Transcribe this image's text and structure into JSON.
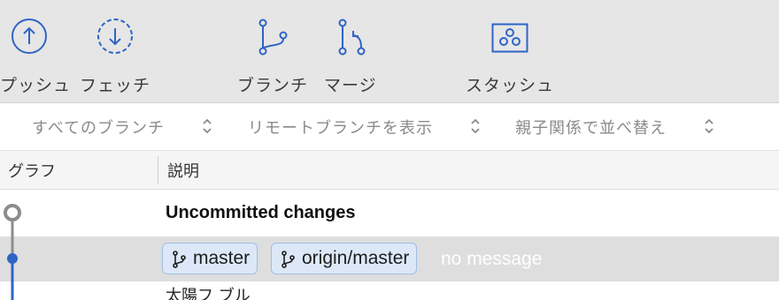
{
  "toolbar": {
    "push_label": "プッシュ",
    "fetch_label": "フェッチ",
    "branch_label": "ブランチ",
    "merge_label": "マージ",
    "stash_label": "スタッシュ"
  },
  "filters": {
    "branches": "すべてのブランチ",
    "remote": "リモートブランチを表示",
    "sort": "親子関係で並べ替え"
  },
  "columns": {
    "graph": "グラフ",
    "description": "説明"
  },
  "rows": [
    {
      "text": "Uncommitted changes"
    },
    {
      "badges": [
        "master",
        "origin/master"
      ],
      "message": "no message"
    },
    {
      "text": "太陽フ ブル"
    }
  ],
  "colors": {
    "accent": "#2f64c6",
    "toolbar_bg": "#e6e6e6",
    "selected_row": "#dedede",
    "badge_bg": "#dce8f8"
  },
  "icons": {
    "push": "arrow-up-circle-icon",
    "fetch": "arrow-down-dashed-circle-icon",
    "branch": "branch-icon",
    "merge": "merge-icon",
    "stash": "stash-box-icon"
  }
}
